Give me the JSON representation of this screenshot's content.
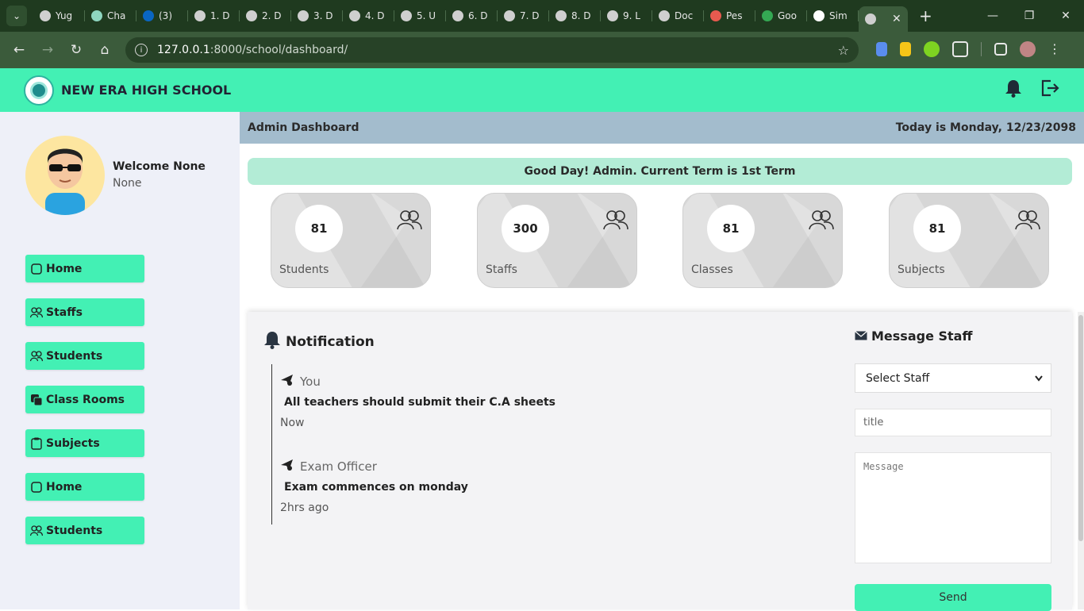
{
  "browser": {
    "tabs": [
      {
        "label": "Yug",
        "color": "#d0d0d0"
      },
      {
        "label": "Cha",
        "color": "#8fd6c0"
      },
      {
        "label": "(3)",
        "color": "#0a66c2"
      },
      {
        "label": "1. D",
        "color": "#cfcfcf"
      },
      {
        "label": "2. D",
        "color": "#cfcfcf"
      },
      {
        "label": "3. D",
        "color": "#cfcfcf"
      },
      {
        "label": "4. D",
        "color": "#cfcfcf"
      },
      {
        "label": "5. U",
        "color": "#cfcfcf"
      },
      {
        "label": "6. D",
        "color": "#cfcfcf"
      },
      {
        "label": "7. D",
        "color": "#cfcfcf"
      },
      {
        "label": "8. D",
        "color": "#cfcfcf"
      },
      {
        "label": "9. L",
        "color": "#cfcfcf"
      },
      {
        "label": "Doc",
        "color": "#cfcfcf"
      },
      {
        "label": "Pes",
        "color": "#e85a4f"
      },
      {
        "label": "Goo",
        "color": "#34a853"
      },
      {
        "label": "Sim",
        "color": "#ffffff"
      }
    ],
    "active_tab_close": "✕",
    "new_tab": "+",
    "url_host": "127.0.0.1",
    "url_rest": ":8000/school/dashboard/"
  },
  "header": {
    "school_name": "NEW ERA HIGH SCHOOL",
    "accent": "#43f0b4"
  },
  "sidebar": {
    "welcome": "Welcome None",
    "subtitle": "None",
    "items": [
      {
        "label": "Home",
        "icon": "square-icon"
      },
      {
        "label": "Staffs",
        "icon": "people-icon"
      },
      {
        "label": "Students",
        "icon": "people-icon"
      },
      {
        "label": "Class Rooms",
        "icon": "copy-icon"
      },
      {
        "label": "Subjects",
        "icon": "clipboard-icon"
      },
      {
        "label": "Home",
        "icon": "square-icon"
      },
      {
        "label": "Students",
        "icon": "people-icon"
      }
    ]
  },
  "main": {
    "page_title": "Admin Dashboard",
    "date_text": "Today is Monday, 12/23/2098",
    "greeting": "Good Day! Admin. Current Term is 1st Term",
    "cards": [
      {
        "value": "81",
        "label": "Students"
      },
      {
        "value": "300",
        "label": "Staffs"
      },
      {
        "value": "81",
        "label": "Classes"
      },
      {
        "value": "81",
        "label": "Subjects"
      }
    ],
    "notification": {
      "title": "Notification",
      "items": [
        {
          "from": "You",
          "message": "All teachers should submit their C.A sheets",
          "time": "Now"
        },
        {
          "from": "Exam Officer",
          "message": "Exam commences on monday",
          "time": "2hrs ago"
        }
      ]
    },
    "message_staff": {
      "title": "Message Staff",
      "select_value": "Select Staff",
      "title_placeholder": "title",
      "message_placeholder": "Message",
      "send_label": "Send"
    }
  }
}
